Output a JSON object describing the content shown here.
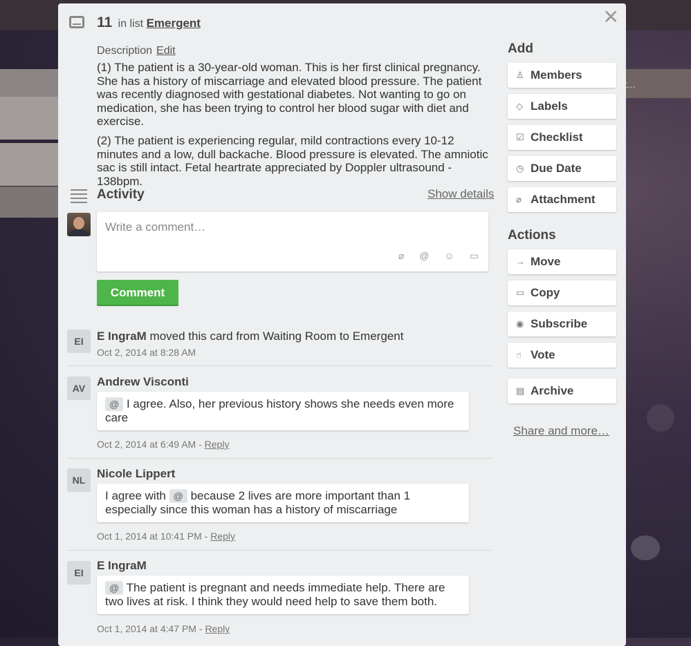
{
  "background": {
    "right_list_text": "st..."
  },
  "header": {
    "card_number": "11",
    "in_list_text": "in list",
    "list_name": "Emergent"
  },
  "description": {
    "label": "Description",
    "edit_label": "Edit",
    "paragraphs": [
      "(1) The patient is a 30-year-old woman. This is her first clinical pregnancy. She has a history of miscarriage and elevated blood pressure. The patient was recently diagnosed with gestational diabetes. Not wanting to go on medication, she has been trying to control her blood sugar with diet and exercise.",
      "(2) The patient is experiencing regular, mild contractions every 10-12 minutes and a low, dull backache. Blood pressure is elevated. The amniotic sac is still intact. Fetal heartrate appreciated by Doppler ultrasound - 138bpm."
    ]
  },
  "activity": {
    "title": "Activity",
    "show_details": "Show details",
    "comment_placeholder": "Write a comment…",
    "comment_button": "Comment",
    "entries": [
      {
        "initials": "EI",
        "name": "E IngraM",
        "action": "moved this card from Waiting Room to Emergent",
        "timestamp": "Oct 2, 2014 at 8:28 AM"
      },
      {
        "initials": "AV",
        "name": "Andrew Visconti",
        "mention": "@",
        "text": "I agree. Also, her previous history shows she needs even more care",
        "timestamp": "Oct 2, 2014 at 6:49 AM",
        "reply": "Reply"
      },
      {
        "initials": "NL",
        "name": "Nicole Lippert",
        "text_before": "I agree with",
        "mention": "@",
        "text_after": "because 2 lives are more important than 1 especially since this woman has a history of miscarriage",
        "timestamp": "Oct 1, 2014 at 10:41 PM",
        "reply": "Reply"
      },
      {
        "initials": "EI",
        "name": "E IngraM",
        "mention": "@",
        "text": "The patient is pregnant and needs immediate help. There are two lives at risk. I think they would need help to save them both.",
        "timestamp": "Oct 1, 2014 at 4:47 PM",
        "reply": "Reply"
      }
    ]
  },
  "sidebar": {
    "add_title": "Add",
    "add_buttons": [
      "Members",
      "Labels",
      "Checklist",
      "Due Date",
      "Attachment"
    ],
    "actions_title": "Actions",
    "action_buttons": [
      "Move",
      "Copy",
      "Subscribe",
      "Vote",
      "Archive"
    ],
    "share_label": "Share and more…"
  }
}
